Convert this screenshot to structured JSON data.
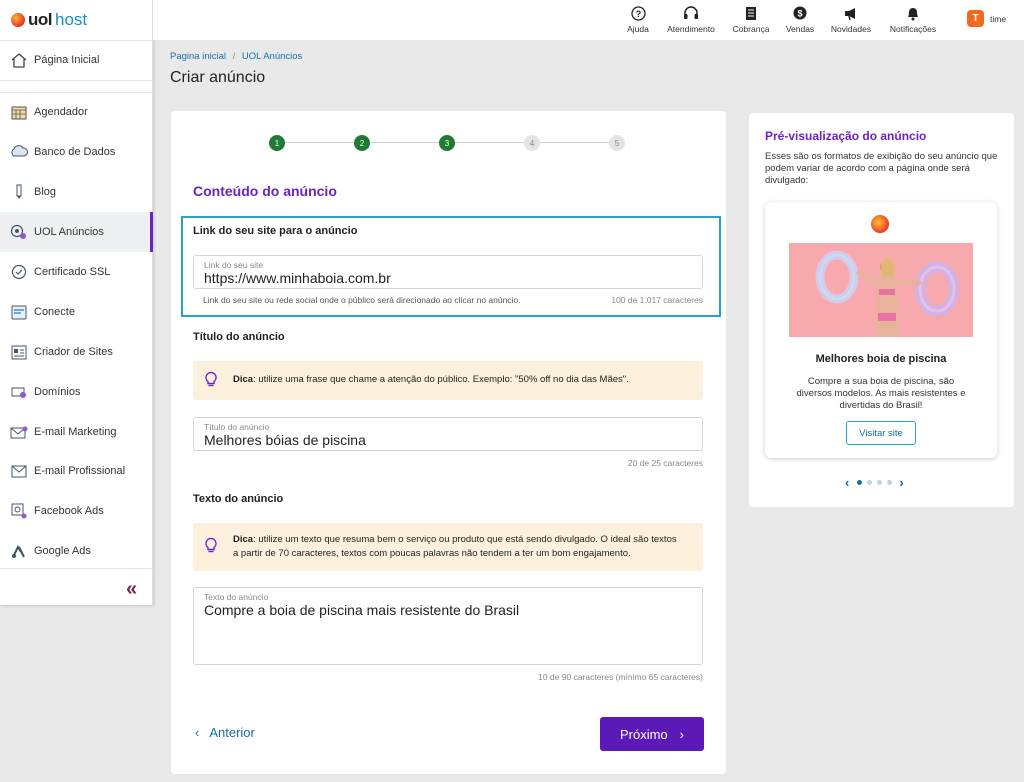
{
  "brand": {
    "uol": "uol",
    "host": "host"
  },
  "sidebar": {
    "items": [
      {
        "label": "Página Inicial",
        "icon": "home-icon"
      },
      {
        "label": "Agendador",
        "icon": "calendar-icon"
      },
      {
        "label": "Banco de Dados",
        "icon": "database-icon"
      },
      {
        "label": "Blog",
        "icon": "pen-icon"
      },
      {
        "label": "UOL Anúncios",
        "icon": "megaphone-icon"
      },
      {
        "label": "Certificado SSL",
        "icon": "certificate-icon"
      },
      {
        "label": "Conecte",
        "icon": "connect-icon"
      },
      {
        "label": "Criador de Sites",
        "icon": "site-builder-icon"
      },
      {
        "label": "Domínios",
        "icon": "domain-icon"
      },
      {
        "label": "E-mail Marketing",
        "icon": "mail-marketing-icon"
      },
      {
        "label": "E-mail Profissional",
        "icon": "mail-icon"
      },
      {
        "label": "Facebook Ads",
        "icon": "facebook-ads-icon"
      },
      {
        "label": "Google Ads",
        "icon": "google-ads-icon"
      }
    ],
    "collapse_label": "«"
  },
  "topbar": {
    "items": [
      {
        "label": "Ajuda",
        "icon": "help-icon"
      },
      {
        "label": "Atendimento",
        "icon": "headset-icon"
      },
      {
        "label": "Cobrança",
        "icon": "invoice-icon"
      },
      {
        "label": "Vendas",
        "icon": "sales-icon"
      },
      {
        "label": "Novidades",
        "icon": "news-icon"
      },
      {
        "label": "Notificações",
        "icon": "bell-icon"
      }
    ],
    "user_initial": "T",
    "user_name": "time"
  },
  "breadcrumb": {
    "home": "Pagina inicial",
    "separator": "/",
    "current": "UOL Anúncios"
  },
  "page_title": "Criar anúncio",
  "steps": [
    "1",
    "2",
    "3",
    "4",
    "5"
  ],
  "form": {
    "section_title": "Conteúdo do anúncio",
    "link": {
      "heading": "Link do seu site para o anúncio",
      "placeholder": "Link do seu site",
      "value": "https://www.minhaboia.com.br",
      "hint": "Link do seu site ou rede social onde o público será direcionado ao clicar no anúncio.",
      "counter": "100 de 1.017 caracteres"
    },
    "title": {
      "heading": "Título do anúncio",
      "tip_bold": "Dica",
      "tip_text": ": utilize uma frase que chame a atenção do público. Exemplo: \"50% off no dia das Mães\".",
      "placeholder": "Título do anúncio",
      "value": "Melhores bóias de piscina",
      "counter": "20 de 25 caracteres"
    },
    "text": {
      "heading": "Texto do anúncio",
      "tip_bold": "Dica",
      "tip_text": ": utilize um texto que resuma bem o serviço ou produto que está sendo divulgado. O ideal são textos a partir de 70 caracteres, textos com poucas palavras não tendem a ter um bom engajamento.",
      "placeholder": "Texto do anúncio",
      "value": "Compre a boia de piscina mais resistente do Brasil",
      "counter": "10 de 90 caracteres (mínimo 65 caracteres)"
    },
    "prev_label": "Anterior",
    "next_label": "Próximo"
  },
  "preview": {
    "title": "Pré-visualização do anúncio",
    "description": "Esses são os formatos de exibição do seu anúncio que podem variar de acordo com a página onde será divulgado:",
    "ad_title": "Melhores boia de piscina",
    "ad_text": "Compre a sua boia de piscina, são diversos modelos. As mais resistentes e divertidas do Brasil!",
    "ad_button": "Visitar site",
    "pages": 5,
    "current_page": 1
  },
  "colors": {
    "accent": "#6d22c4",
    "primary_button": "#5b1ab8",
    "step_done": "#1e7b34",
    "link": "#1a6fa8",
    "focus_border": "#25a5c6",
    "tip_bg": "#fdf1dd"
  }
}
